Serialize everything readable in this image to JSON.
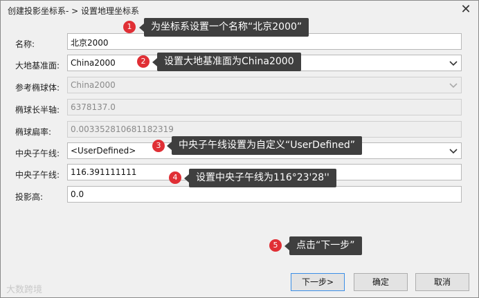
{
  "window": {
    "title": "创建投影坐标系- > 设置地理坐标系",
    "close_glyph": "✕"
  },
  "form": {
    "name": {
      "label": "名称:",
      "value": "北京2000"
    },
    "datum": {
      "label": "大地基准面:",
      "value": "China2000"
    },
    "ellipsoid": {
      "label": "参考椭球体:",
      "value": "China2000"
    },
    "semi_major": {
      "label": "椭球长半轴:",
      "value": "6378137.0"
    },
    "flattening": {
      "label": "椭球扁率:",
      "value": "0.003352810681182319"
    },
    "meridian_select": {
      "label": "中央子午线:",
      "value": "<UserDefined>"
    },
    "meridian_value": {
      "label": "中央子午线:",
      "value": "116.391111111"
    },
    "projection_height": {
      "label": "投影高:",
      "value": "0.0"
    }
  },
  "callouts": [
    {
      "num": "1",
      "text": "为坐标系设置一个名称“北京2000”"
    },
    {
      "num": "2",
      "text": "设置大地基准面为China2000"
    },
    {
      "num": "3",
      "text": "中央子午线设置为自定义“UserDefined”"
    },
    {
      "num": "4",
      "text": "设置中央子午线为116°23'28''"
    },
    {
      "num": "5",
      "text": "点击“下一步”"
    }
  ],
  "buttons": {
    "next": "下一步>",
    "ok": "确定",
    "cancel": "取消"
  },
  "watermark": "大数跨境",
  "colors": {
    "badge": "#e02f35",
    "callout_bg": "#3f3f3f",
    "dialog_bg": "#f0f0f0"
  },
  "icons": {
    "close": "close-icon",
    "dropdown": "chevron-down-icon"
  }
}
